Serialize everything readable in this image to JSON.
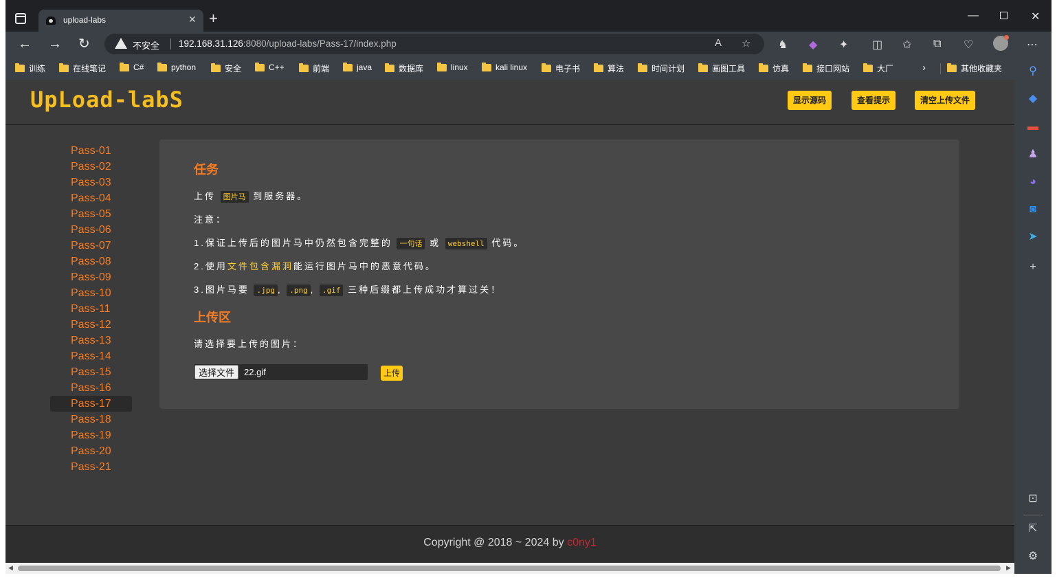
{
  "browser": {
    "tab_title": "upload-labs",
    "security_label": "不安全",
    "url_host": "192.168.31.126",
    "url_rest": ":8080/upload-labs/Pass-17/index.php"
  },
  "bookmarks": [
    "训练",
    "在线笔记",
    "C#",
    "python",
    "安全",
    "C++",
    "前端",
    "java",
    "数据库",
    "linux",
    "kali linux",
    "电子书",
    "算法",
    "时间计划",
    "画图工具",
    "仿真",
    "接口网站",
    "大厂"
  ],
  "other_bookmarks": "其他收藏夹",
  "site": {
    "logo": "UpLoad-labS",
    "buttons": [
      "显示源码",
      "查看提示",
      "清空上传文件"
    ]
  },
  "nav": {
    "items": [
      "Pass-01",
      "Pass-02",
      "Pass-03",
      "Pass-04",
      "Pass-05",
      "Pass-06",
      "Pass-07",
      "Pass-08",
      "Pass-09",
      "Pass-10",
      "Pass-11",
      "Pass-12",
      "Pass-13",
      "Pass-14",
      "Pass-15",
      "Pass-16",
      "Pass-17",
      "Pass-18",
      "Pass-19",
      "Pass-20",
      "Pass-21"
    ],
    "active": "Pass-17"
  },
  "task": {
    "title": "任务",
    "line1_a": "上传",
    "line1_code": "图片马",
    "line1_b": "到服务器。",
    "note": "注意：",
    "item1_a": "1.保证上传后的图片马中仍然包含完整的",
    "item1_code1": "一句话",
    "item1_mid": "或",
    "item1_code2": "webshell",
    "item1_b": "代码。",
    "item2_a": "2.使用",
    "item2_hl": "文件包含漏洞",
    "item2_b": "能运行图片马中的恶意代码。",
    "item3_a": "3.图片马要",
    "ext1": ".jpg",
    "comma": ",",
    "ext2": ".png",
    "ext3": ".gif",
    "item3_b": "三种后缀都上传成功才算过关！"
  },
  "upload": {
    "title": "上传区",
    "prompt": "请选择要上传的图片：",
    "choose_button": "选择文件",
    "file_name": "22.gif",
    "submit": "上传"
  },
  "footer": {
    "text": "Copyright @ 2018 ~ 2024 by",
    "author": "c0ny1"
  }
}
